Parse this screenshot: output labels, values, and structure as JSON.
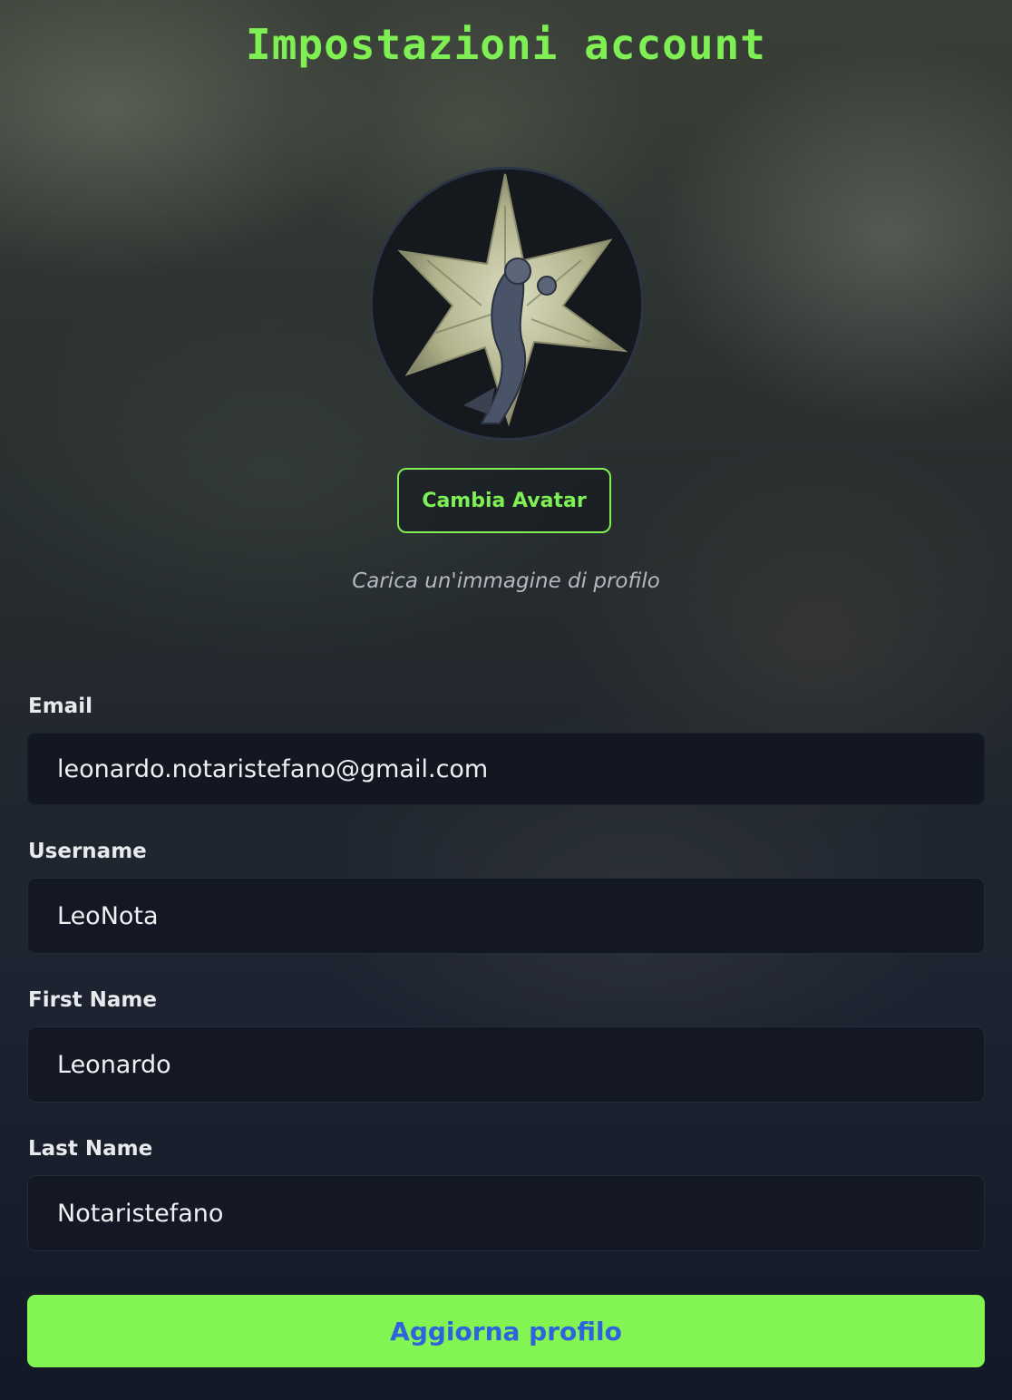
{
  "page": {
    "title": "Impostazioni account"
  },
  "avatar": {
    "change_button": "Cambia Avatar",
    "hint": "Carica un'immagine di profilo"
  },
  "form": {
    "email": {
      "label": "Email",
      "value": "leonardo.notaristefano@gmail.com"
    },
    "username": {
      "label": "Username",
      "value": "LeoNota"
    },
    "first_name": {
      "label": "First Name",
      "value": "Leonardo"
    },
    "last_name": {
      "label": "Last Name",
      "value": "Notaristefano"
    },
    "submit_label": "Aggiorna profilo"
  },
  "colors": {
    "accent_green": "#7ef054",
    "submit_bg": "#82f552",
    "submit_text": "#2f62dd",
    "field_bg": "#131824"
  }
}
